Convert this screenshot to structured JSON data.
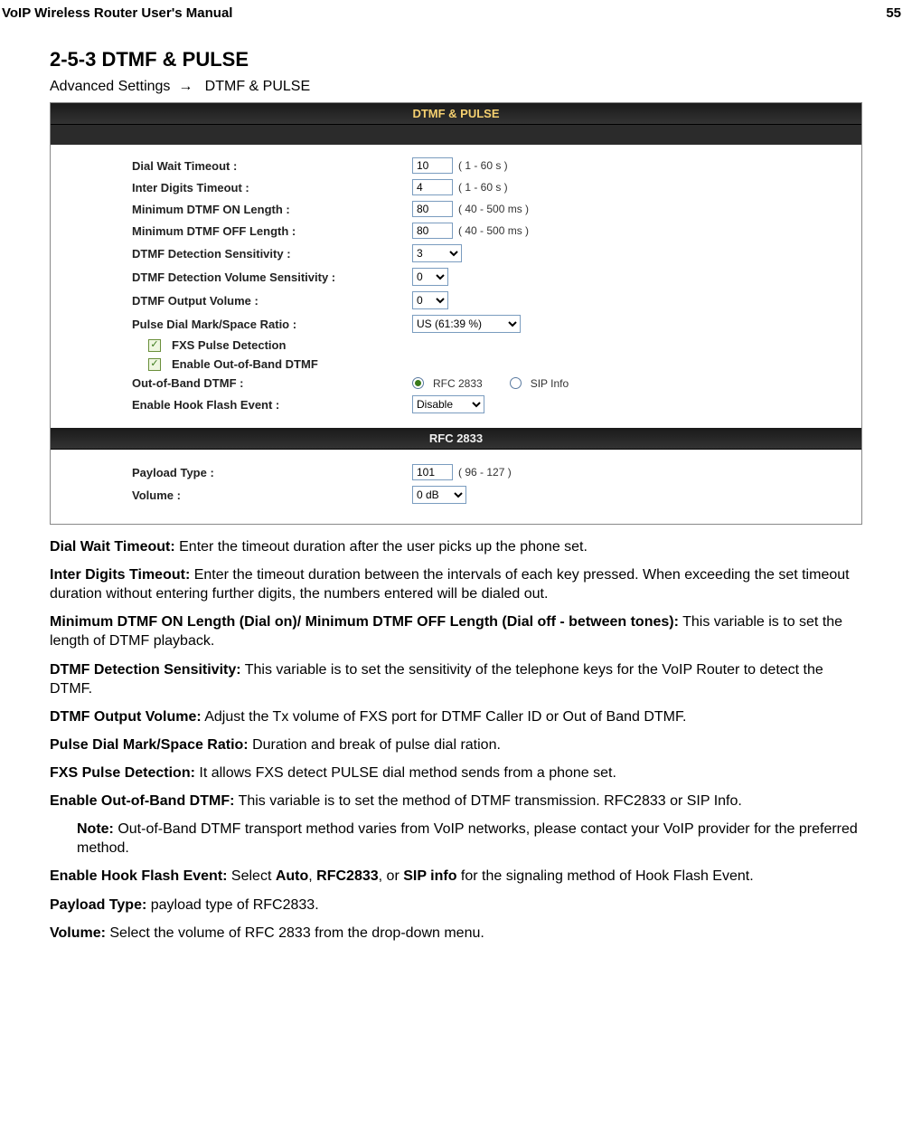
{
  "header": {
    "left": "VoIP Wireless Router User's Manual",
    "right": "55"
  },
  "heading": "2-5-3 DTMF & PULSE",
  "breadcrumb": {
    "a": "Advanced Settings",
    "arrow": "→",
    "b": "DTMF & PULSE"
  },
  "ui": {
    "title1": "DTMF & PULSE",
    "title2": "RFC 2833",
    "rows": {
      "dial_wait": {
        "label": "Dial Wait Timeout :",
        "value": "10",
        "hint": "( 1 - 60 s )"
      },
      "inter_digit": {
        "label": "Inter Digits Timeout :",
        "value": "4",
        "hint": "( 1 - 60 s )"
      },
      "min_on": {
        "label": "Minimum DTMF ON Length :",
        "value": "80",
        "hint": "( 40 - 500 ms )"
      },
      "min_off": {
        "label": "Minimum DTMF OFF Length :",
        "value": "80",
        "hint": "( 40 - 500 ms )"
      },
      "det_sens": {
        "label": "DTMF Detection Sensitivity :",
        "value": "3"
      },
      "det_vol": {
        "label": "DTMF Detection Volume Sensitivity :",
        "value": "0"
      },
      "out_vol": {
        "label": "DTMF Output Volume :",
        "value": "0"
      },
      "pulse_ratio": {
        "label": "Pulse Dial Mark/Space Ratio :",
        "value": "US (61:39 %)"
      },
      "cb1": {
        "label": "FXS Pulse Detection"
      },
      "cb2": {
        "label": "Enable Out-of-Band DTMF"
      },
      "oob": {
        "label": "Out-of-Band DTMF :",
        "opt1": "RFC 2833",
        "opt2": "SIP Info"
      },
      "hook": {
        "label": "Enable Hook Flash Event :",
        "value": "Disable"
      },
      "payload": {
        "label": "Payload Type :",
        "value": "101",
        "hint": "( 96 - 127 )"
      },
      "volume": {
        "label": "Volume :",
        "value": "0 dB"
      }
    }
  },
  "text": {
    "p1b": "Dial Wait Timeout:",
    "p1": " Enter the timeout duration after the user picks up the phone set.",
    "p2b": "Inter Digits Timeout:",
    "p2": " Enter the timeout duration between the intervals of each key pressed. When exceeding the set timeout duration without entering further digits, the numbers entered will be dialed out.",
    "p3b": "Minimum DTMF ON Length (Dial on)/ Minimum DTMF OFF Length (Dial off - between tones):",
    "p3": " This variable is to set the length of DTMF playback.",
    "p4b": "DTMF Detection Sensitivity:",
    "p4": " This variable is to set the sensitivity of the telephone keys for the VoIP Router to detect the DTMF.",
    "p5b": "DTMF Output Volume:",
    "p5": " Adjust the Tx volume of FXS port for DTMF Caller ID or Out of Band DTMF.",
    "p6b": "Pulse Dial Mark/Space Ratio:",
    "p6": " Duration and break of pulse dial ration.",
    "p7b": "FXS Pulse Detection:",
    "p7": " It allows FXS detect PULSE dial method sends from a phone set.",
    "p8b": "Enable Out-of-Band DTMF:",
    "p8": " This variable is to set the method of DTMF transmission. RFC2833 or SIP Info.",
    "noteb": "Note:",
    "note": " Out-of-Band DTMF transport method varies from VoIP networks, please contact your VoIP provider for the preferred method.",
    "p9a": "Enable Hook Flash Event:",
    "p9b": " Select ",
    "p9c": "Auto",
    "p9d": ", ",
    "p9e": "RFC2833",
    "p9f": ", or ",
    "p9g": "SIP info",
    "p9h": " for the signaling method of Hook Flash Event.",
    "p10b": "Payload Type:",
    "p10": " payload type of RFC2833.",
    "p11b": "Volume:",
    "p11": " Select the volume of RFC 2833 from the drop-down menu."
  }
}
